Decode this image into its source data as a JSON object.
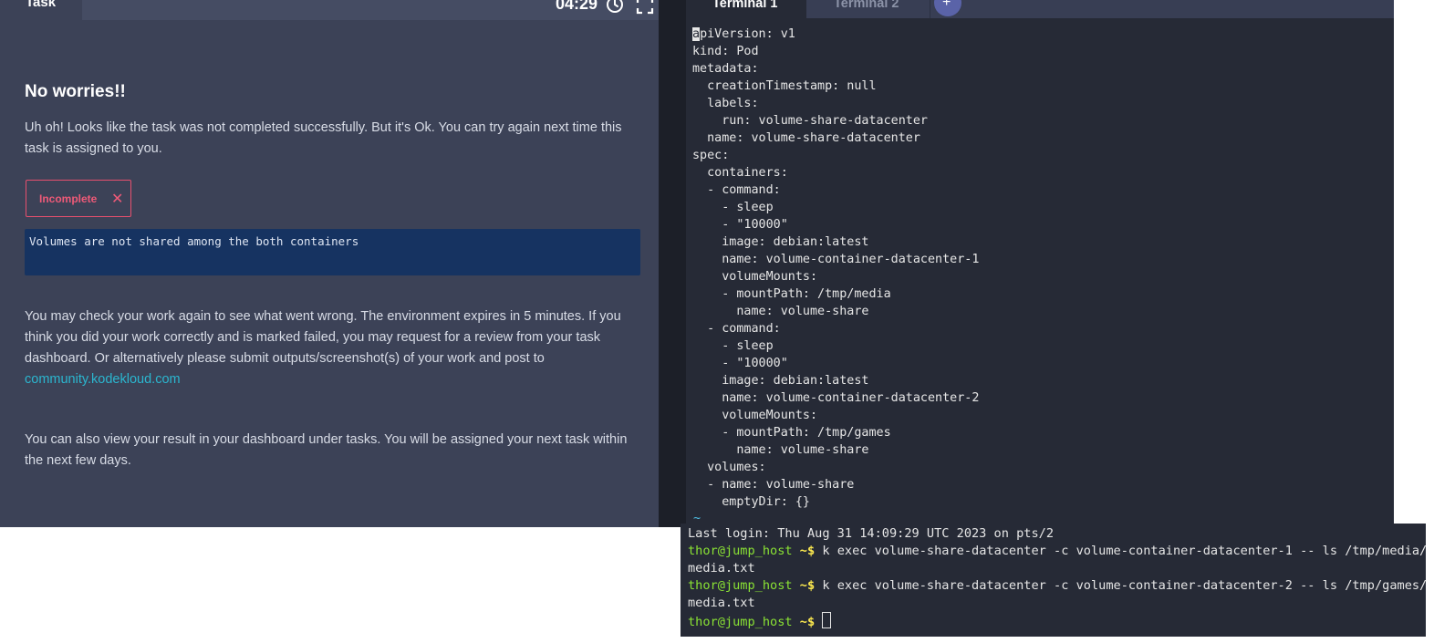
{
  "task_panel": {
    "tab_label": "Task",
    "timer": "04:29",
    "heading": "No worries!!",
    "intro": "Uh oh! Looks like the task was not completed successfully. But it's Ok. You can try again next time this task is assigned to you.",
    "status_badge": "Incomplete",
    "status_icon": "✕",
    "error_message": "Volumes are not shared among the both containers",
    "check_text": "You may check your work again to see what went wrong. The environment expires in 5 minutes. If you think you did your work correctly and is marked failed, you may request for a review from your task dashboard. Or alternatively please submit outputs/screenshot(s) of your work and post to",
    "community_link": "community.kodekloud.com",
    "dashboard_text": "You can also view your result in your dashboard under tasks. You will be assigned your next task within the next few days."
  },
  "terminal": {
    "tabs": [
      {
        "label": "Terminal 1",
        "active": true
      },
      {
        "label": "Terminal 2",
        "active": false
      }
    ],
    "add_tab_label": "+",
    "editor_first_char": "a",
    "editor_lines": [
      "piVersion: v1",
      "kind: Pod",
      "metadata:",
      "  creationTimestamp: null",
      "  labels:",
      "    run: volume-share-datacenter",
      "  name: volume-share-datacenter",
      "spec:",
      "  containers:",
      "  - command:",
      "    - sleep",
      "    - \"10000\"",
      "    image: debian:latest",
      "    name: volume-container-datacenter-1",
      "    volumeMounts:",
      "    - mountPath: /tmp/media",
      "      name: volume-share",
      "  - command:",
      "    - sleep",
      "    - \"10000\"",
      "    image: debian:latest",
      "    name: volume-container-datacenter-2",
      "    volumeMounts:",
      "    - mountPath: /tmp/games",
      "      name: volume-share",
      "  volumes:",
      "  - name: volume-share",
      "    emptyDir: {}"
    ],
    "tilde": "~",
    "shell": {
      "last_login": "Last login: Thu Aug 31 14:09:29 UTC 2023 on pts/2",
      "prompt_user": "thor@jump_host",
      "prompt_symbol": " ~$ ",
      "cmd1": "k exec volume-share-datacenter -c volume-container-datacenter-1 -- ls /tmp/media/",
      "out1": "media.txt",
      "cmd2": "k exec volume-share-datacenter -c volume-container-datacenter-2 -- ls /tmp/games/",
      "out2": "media.txt"
    }
  },
  "colors": {
    "panel_bg": "#3c4257",
    "terminal_bg": "#262a36",
    "error_pink": "#ef5a78",
    "link_cyan": "#2bb6cf",
    "prompt_green": "#8ae234"
  }
}
